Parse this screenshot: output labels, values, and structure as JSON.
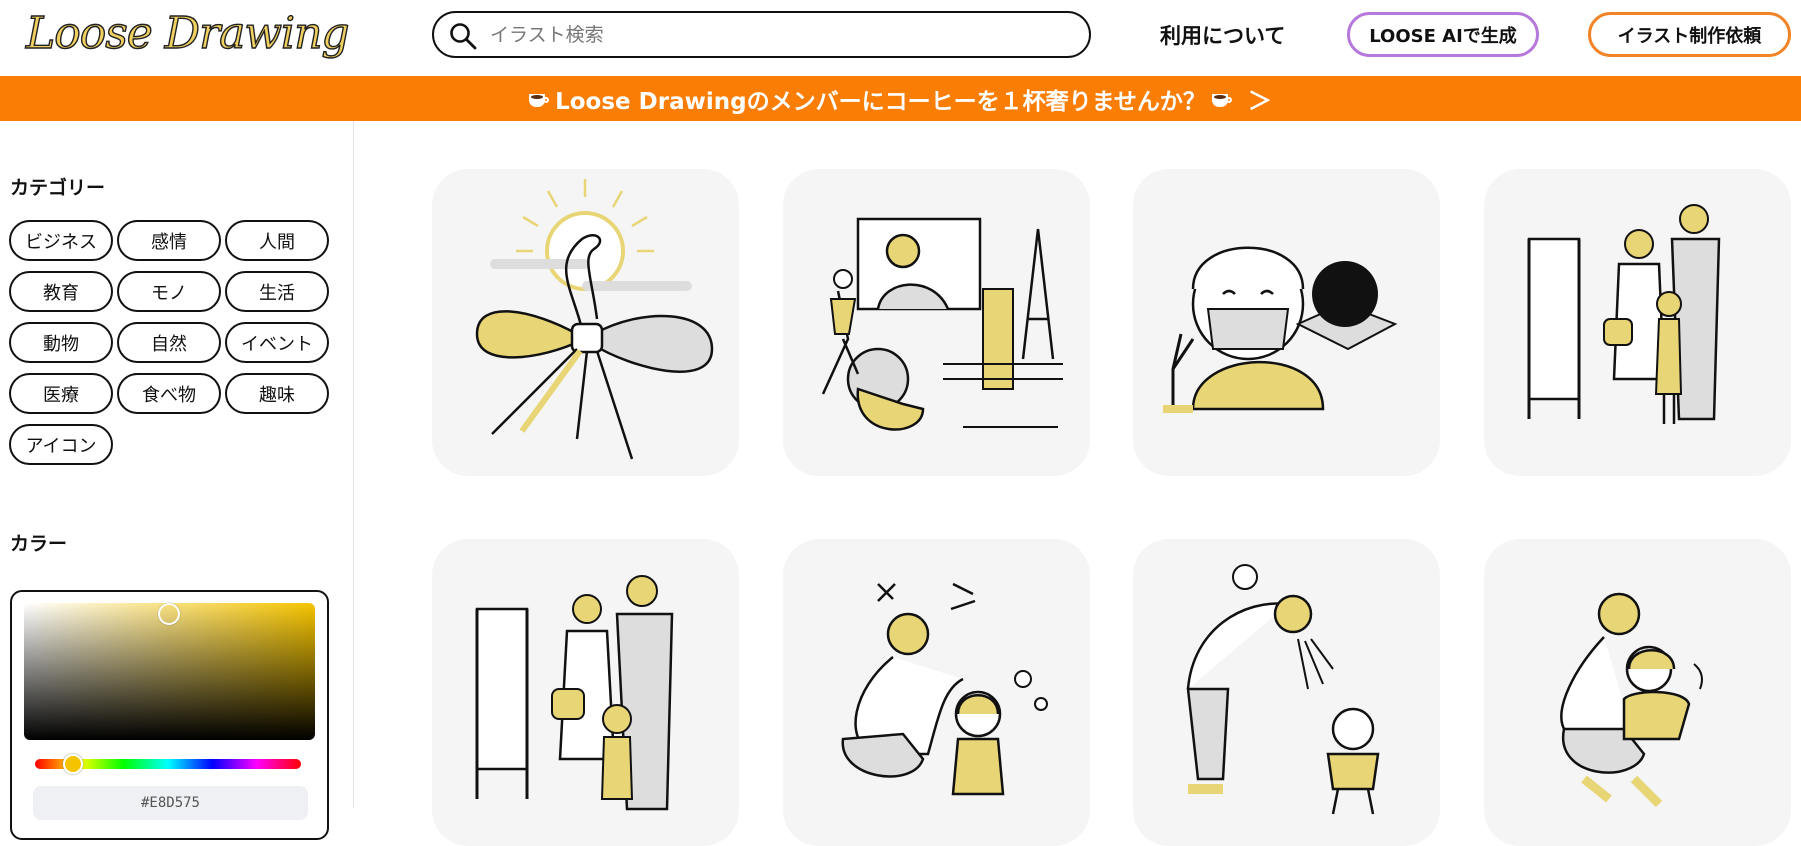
{
  "header": {
    "logo_text": "Loose Drawing",
    "search_placeholder": "イラスト検索",
    "nav_about": "利用について",
    "ai_button": "LOOSE AIで生成",
    "request_button": "イラスト制作依頼"
  },
  "banner": {
    "text": "Loose Drawingのメンバーにコーヒーを１杯奢りませんか？",
    "arrow": "＞"
  },
  "sidebar": {
    "category_title": "カテゴリー",
    "categories": [
      "ビジネス",
      "感情",
      "人間",
      "教育",
      "モノ",
      "生活",
      "動物",
      "自然",
      "イベント",
      "医療",
      "食べ物",
      "趣味",
      "アイコン"
    ],
    "color_title": "カラー",
    "color_hex": "#E8D575"
  },
  "colors": {
    "accent_orange": "#FA7D05",
    "ai_border": "#B678DA",
    "request_border": "#F08426",
    "illustration_yellow": "#E8D575"
  },
  "gallery": {
    "items": [
      {
        "icon": "mizuhiki-snake-illustration"
      },
      {
        "icon": "city-robot-video-illustration"
      },
      {
        "icon": "masked-person-peace-illustration"
      },
      {
        "icon": "family-school-gate-illustration"
      },
      {
        "icon": "family-ceremony-illustration"
      },
      {
        "icon": "parent-child-walking-illustration"
      },
      {
        "icon": "parent-scolding-child-illustration"
      },
      {
        "icon": "parent-hugging-child-illustration"
      }
    ]
  }
}
